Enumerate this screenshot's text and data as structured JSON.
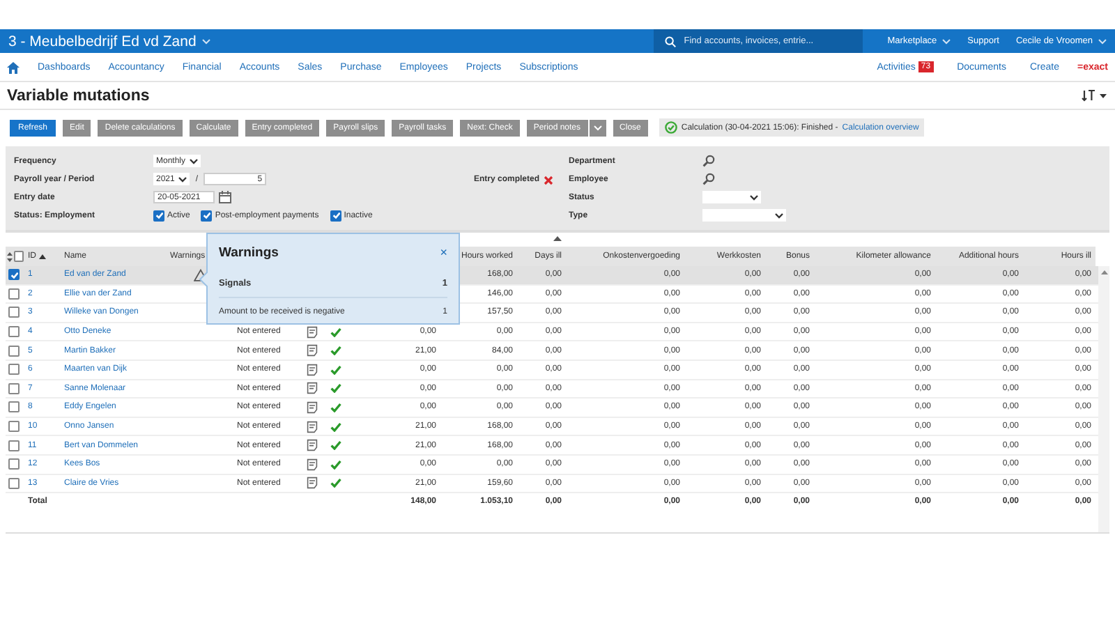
{
  "topbar": {
    "company": "3 - Meubelbedrijf Ed vd Zand",
    "search": {
      "placeholder": "Find accounts, invoices, entrie..."
    },
    "links": [
      {
        "label": "Marketplace",
        "caret": true
      },
      {
        "label": "Support",
        "caret": false
      },
      {
        "label": "Cecile de Vroomen",
        "caret": true
      }
    ]
  },
  "nav": {
    "items": [
      "Dashboards",
      "Accountancy",
      "Financial",
      "Accounts",
      "Sales",
      "Purchase",
      "Employees",
      "Projects",
      "Subscriptions"
    ],
    "activities": {
      "label": "Activities",
      "badge": "73"
    },
    "right": [
      "Documents",
      "Create"
    ],
    "logo": "=exact"
  },
  "title": "Variable mutations",
  "toolbar": {
    "buttons": [
      {
        "label": "Refresh",
        "kind": "primary"
      },
      {
        "label": "Edit",
        "kind": "plain"
      },
      {
        "label": "Delete calculations",
        "kind": "plain"
      },
      {
        "label": "Calculate",
        "kind": "plain"
      },
      {
        "label": "Entry completed",
        "kind": "plain"
      },
      {
        "label": "Payroll slips",
        "kind": "plain"
      },
      {
        "label": "Payroll tasks",
        "kind": "plain"
      },
      {
        "label": "Next: Check",
        "kind": "plain"
      },
      {
        "label": "Period notes",
        "kind": "split"
      },
      {
        "label": "Close",
        "kind": "plain"
      }
    ],
    "status": {
      "text": "Calculation (30-04-2021 15:06): Finished - ",
      "link": "Calculation overview"
    }
  },
  "filters": {
    "frequency": {
      "label": "Frequency",
      "value": "Monthly"
    },
    "period": {
      "label": "Payroll year / Period",
      "year": "2021",
      "separator": "/",
      "period": "5"
    },
    "entry_date": {
      "label": "Entry date",
      "value": "20-05-2021"
    },
    "employment": {
      "label": "Status: Employment",
      "options": [
        {
          "label": "Active",
          "checked": true
        },
        {
          "label": "Post-employment payments",
          "checked": true
        },
        {
          "label": "Inactive",
          "checked": true
        }
      ]
    },
    "entry_completed": {
      "label": "Entry completed",
      "done": false
    },
    "department": {
      "label": "Department"
    },
    "employee": {
      "label": "Employee"
    },
    "status": {
      "label": "Status"
    },
    "type": {
      "label": "Type"
    }
  },
  "table": {
    "all_selected": false,
    "columns": [
      "ID",
      "Name",
      "Warnings",
      "Hours worked",
      "Days ill",
      "Onkostenvergoeding",
      "Werkkosten",
      "Bonus",
      "Kilometer allowance",
      "Additional hours",
      "Hours ill"
    ],
    "rows": [
      {
        "selected": true,
        "id": "1",
        "name": "Ed van der Zand",
        "warning": true,
        "values": [
          "168,00",
          "0,00",
          "0,00",
          "0,00",
          "0,00",
          "0,00",
          "0,00",
          "0,00"
        ]
      },
      {
        "selected": false,
        "id": "2",
        "name": "Ellie van der Zand",
        "warning": false,
        "values": [
          "146,00",
          "0,00",
          "0,00",
          "0,00",
          "0,00",
          "0,00",
          "0,00",
          "0,00"
        ]
      },
      {
        "selected": false,
        "id": "3",
        "name": "Willeke van Dongen",
        "warning": false,
        "values": [
          "157,50",
          "0,00",
          "0,00",
          "0,00",
          "0,00",
          "0,00",
          "0,00",
          "0,00"
        ]
      },
      {
        "selected": false,
        "id": "4",
        "name": "Otto Deneke",
        "warning": false,
        "status": "Not entered",
        "column_8": "0,00",
        "values": [
          "0,00",
          "0,00",
          "0,00",
          "0,00",
          "0,00",
          "0,00",
          "0,00",
          "0,00"
        ]
      },
      {
        "selected": false,
        "id": "5",
        "name": "Martin Bakker",
        "warning": false,
        "status": "Not entered",
        "column_8": "21,00",
        "values": [
          "84,00",
          "0,00",
          "0,00",
          "0,00",
          "0,00",
          "0,00",
          "0,00",
          "0,00"
        ]
      },
      {
        "selected": false,
        "id": "6",
        "name": "Maarten van Dijk",
        "warning": false,
        "status": "Not entered",
        "column_8": "0,00",
        "values": [
          "0,00",
          "0,00",
          "0,00",
          "0,00",
          "0,00",
          "0,00",
          "0,00",
          "0,00"
        ]
      },
      {
        "selected": false,
        "id": "7",
        "name": "Sanne Molenaar",
        "warning": false,
        "status": "Not entered",
        "column_8": "0,00",
        "values": [
          "0,00",
          "0,00",
          "0,00",
          "0,00",
          "0,00",
          "0,00",
          "0,00",
          "0,00"
        ]
      },
      {
        "selected": false,
        "id": "8",
        "name": "Eddy Engelen",
        "warning": false,
        "status": "Not entered",
        "column_8": "0,00",
        "values": [
          "0,00",
          "0,00",
          "0,00",
          "0,00",
          "0,00",
          "0,00",
          "0,00",
          "0,00"
        ]
      },
      {
        "selected": false,
        "id": "10",
        "name": "Onno Jansen",
        "warning": false,
        "status": "Not entered",
        "column_8": "21,00",
        "values": [
          "168,00",
          "0,00",
          "0,00",
          "0,00",
          "0,00",
          "0,00",
          "0,00",
          "0,00"
        ]
      },
      {
        "selected": false,
        "id": "11",
        "name": "Bert van Dommelen",
        "warning": false,
        "status": "Not entered",
        "column_8": "21,00",
        "values": [
          "168,00",
          "0,00",
          "0,00",
          "0,00",
          "0,00",
          "0,00",
          "0,00",
          "0,00"
        ]
      },
      {
        "selected": false,
        "id": "12",
        "name": "Kees Bos",
        "warning": false,
        "status": "Not entered",
        "column_8": "0,00",
        "values": [
          "0,00",
          "0,00",
          "0,00",
          "0,00",
          "0,00",
          "0,00",
          "0,00",
          "0,00"
        ]
      },
      {
        "selected": false,
        "id": "13",
        "name": "Claire de Vries",
        "warning": false,
        "status": "Not entered",
        "column_8": "21,00",
        "values": [
          "159,60",
          "0,00",
          "0,00",
          "0,00",
          "0,00",
          "0,00",
          "0,00",
          "0,00"
        ]
      }
    ],
    "total": {
      "label": "Total",
      "column_8": "148,00",
      "values": [
        "1.053,10",
        "0,00",
        "0,00",
        "0,00",
        "0,00",
        "0,00",
        "0,00",
        "0,00"
      ]
    }
  },
  "popup": {
    "title": "Warnings",
    "close": "×",
    "items": [
      {
        "label": "Signals",
        "count": "1",
        "kind": "group"
      },
      {
        "label": "Amount to be received is negative",
        "count": "1",
        "kind": "item"
      }
    ]
  }
}
